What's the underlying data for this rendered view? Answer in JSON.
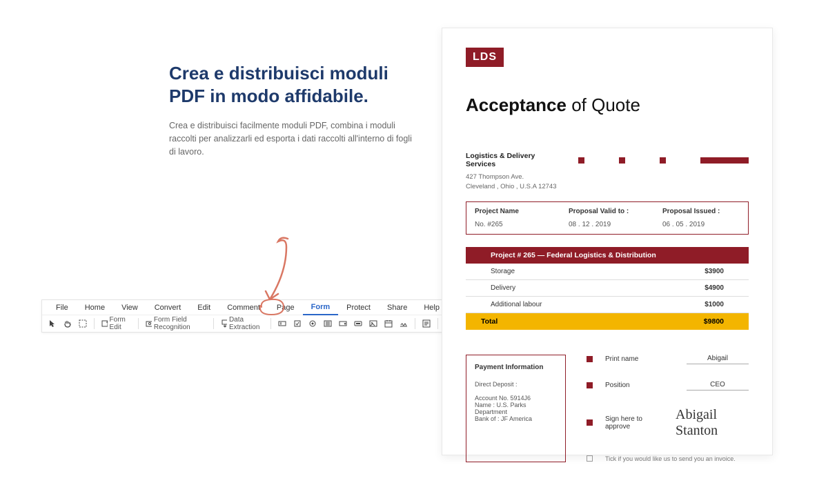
{
  "marketing": {
    "headline": "Crea e distribuisci moduli PDF in modo affidabile.",
    "subtext": "Crea e distribuisci facilmente moduli PDF, combina i moduli raccolti per analizzarli ed esporta i dati raccolti all'interno di fogli di lavoro."
  },
  "ribbon": {
    "menus": {
      "file": "File",
      "home": "Home",
      "view": "View",
      "convert": "Convert",
      "edit": "Edit",
      "comment": "Comment",
      "page": "Page",
      "form": "Form",
      "protect": "Protect",
      "share": "Share",
      "help": "Help"
    },
    "tools": {
      "form_edit": "Form Edit",
      "field_recognition": "Form Field Recognition",
      "data_extraction": "Data Extraction"
    }
  },
  "doc": {
    "logo": "LDS",
    "title_bold": "Acceptance",
    "title_rest": " of Quote",
    "company": "Logistics & Delivery Services",
    "addr1": "427 Thompson Ave.",
    "addr2": "Cleveland , Ohio , U.S.A 12743",
    "info": {
      "project_name_label": "Project Name",
      "project_name_val": "No. #265",
      "valid_label": "Proposal Valid to :",
      "valid_val": "08 . 12 . 2019",
      "issued_label": "Proposal Issued :",
      "issued_val": "06 . 05 . 2019"
    },
    "table": {
      "head": "Project # 265 — Federal Logistics & Distribution",
      "rows": [
        {
          "name": "Storage",
          "val": "$3900"
        },
        {
          "name": "Delivery",
          "val": "$4900"
        },
        {
          "name": "Additional labour",
          "val": "$1000"
        }
      ],
      "total_label": "Total",
      "total_val": "$9800"
    },
    "pay": {
      "heading": "Payment Information",
      "dd": "Direct Deposit :",
      "acct": "Account No. 5914J6",
      "name": "Name :  U.S. Parks Department",
      "bank": "Bank of :  JF America"
    },
    "sign": {
      "print_label": "Print name",
      "print_val": "Abigail",
      "position_label": "Position",
      "position_val": "CEO",
      "sign_label": "Sign here to approve",
      "sign_val": "Abigail  Stanton",
      "tick_text": "Tick if you would like us to send you an invoice."
    }
  }
}
